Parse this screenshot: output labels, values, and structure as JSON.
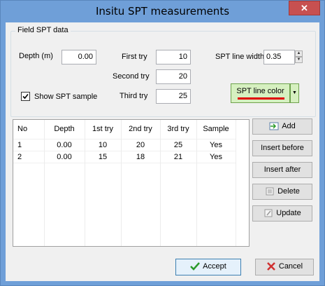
{
  "window": {
    "title": "Insitu SPT measurements",
    "close_glyph": "✕"
  },
  "group": {
    "title": "Field SPT data",
    "depth_label": "Depth (m)",
    "depth_value": "0.00",
    "show_sample_label": "Show SPT sample",
    "show_sample_checked": true,
    "first_try_label": "First try",
    "first_try_value": "10",
    "second_try_label": "Second try",
    "second_try_value": "20",
    "third_try_label": "Third try",
    "third_try_value": "25",
    "line_width_label": "SPT line width",
    "line_width_value": "0.35",
    "line_color_label": "SPT line color",
    "line_color": "#e00000"
  },
  "table": {
    "columns": [
      "No",
      "Depth",
      "1st try",
      "2nd try",
      "3rd try",
      "Sample"
    ],
    "rows": [
      [
        "1",
        "0.00",
        "10",
        "20",
        "25",
        "Yes"
      ],
      [
        "2",
        "0.00",
        "15",
        "18",
        "21",
        "Yes"
      ]
    ]
  },
  "side_buttons": {
    "add": "Add",
    "insert_before": "Insert before",
    "insert_after": "Insert after",
    "delete": "Delete",
    "update": "Update"
  },
  "footer": {
    "accept": "Accept",
    "cancel": "Cancel"
  },
  "icons": {
    "checkmark": "check-icon",
    "cancel": "x-icon",
    "accept_color": "#2a9a2a",
    "cancel_color": "#d03030"
  }
}
